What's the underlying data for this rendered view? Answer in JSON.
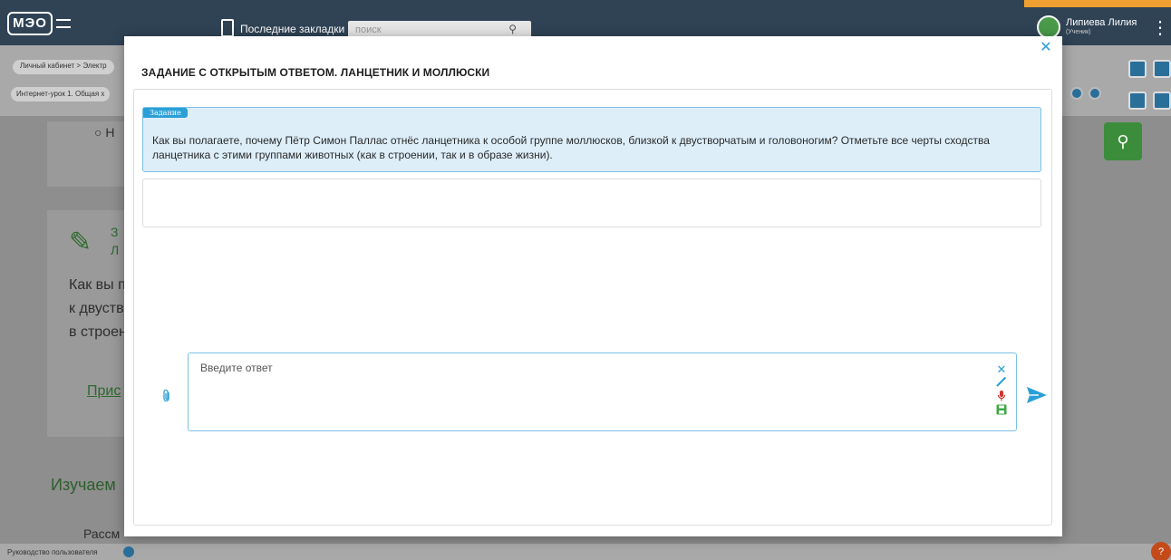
{
  "app": {
    "logo_text": "МЭО",
    "bookmarks_label": "Последние закладки",
    "search_placeholder": "поиск",
    "user_name": "Липиева Лилия",
    "user_role": "(Ученик)"
  },
  "breadcrumbs": {
    "item1": "Личный кабинет",
    "item2": "Электр",
    "lesson": "Интернет-урок 1. Общая х"
  },
  "background": {
    "option_marker": "○ Н",
    "pencil_text_a": "З",
    "pencil_text_b": "Л",
    "question_lines": [
      "Как вы п",
      "к двуств",
      "в строен"
    ],
    "link_text": "Прис",
    "section_heading": "Изучаем",
    "partial_text": "Рассм",
    "footer_link": "Руководство пользователя",
    "help_label": "?"
  },
  "modal": {
    "title": "ЗАДАНИЕ С ОТКРЫТЫМ ОТВЕТОМ. ЛАНЦЕТНИК И МОЛЛЮСКИ",
    "task_tag": "Задание",
    "task_text": "Как вы полагаете, почему Пётр Симон Паллас отнёс ланцетника к особой группе моллюсков, близкой к двустворчатым и головоногим? Отметьте все черты сходства ланцетника с этими группами животных (как в строении, так и в образе жизни).",
    "answer_placeholder": "Введите ответ"
  },
  "colors": {
    "accent": "#2a9fd6",
    "tool_clear": "#2a9fd6",
    "tool_draw": "#2a9fd6",
    "tool_mic": "#d0342c",
    "tool_save": "#3fa845"
  },
  "icons": {
    "close": "close-icon",
    "attach": "paperclip-icon",
    "clear": "clear-icon",
    "draw": "pen-icon",
    "mic": "microphone-icon",
    "save": "save-icon",
    "send": "send-icon"
  }
}
